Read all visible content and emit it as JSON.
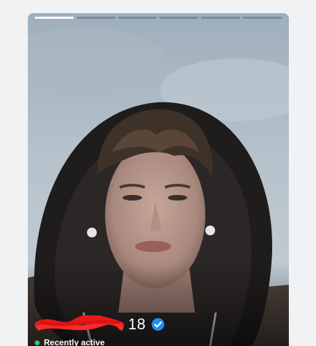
{
  "profile": {
    "age": "18",
    "status_text": "Recently active",
    "photo_count": 6,
    "active_photo_index": 0,
    "verified_icon": "verified-check-icon",
    "status_color": "#21d07a",
    "verified_color": "#1f8ef1"
  }
}
